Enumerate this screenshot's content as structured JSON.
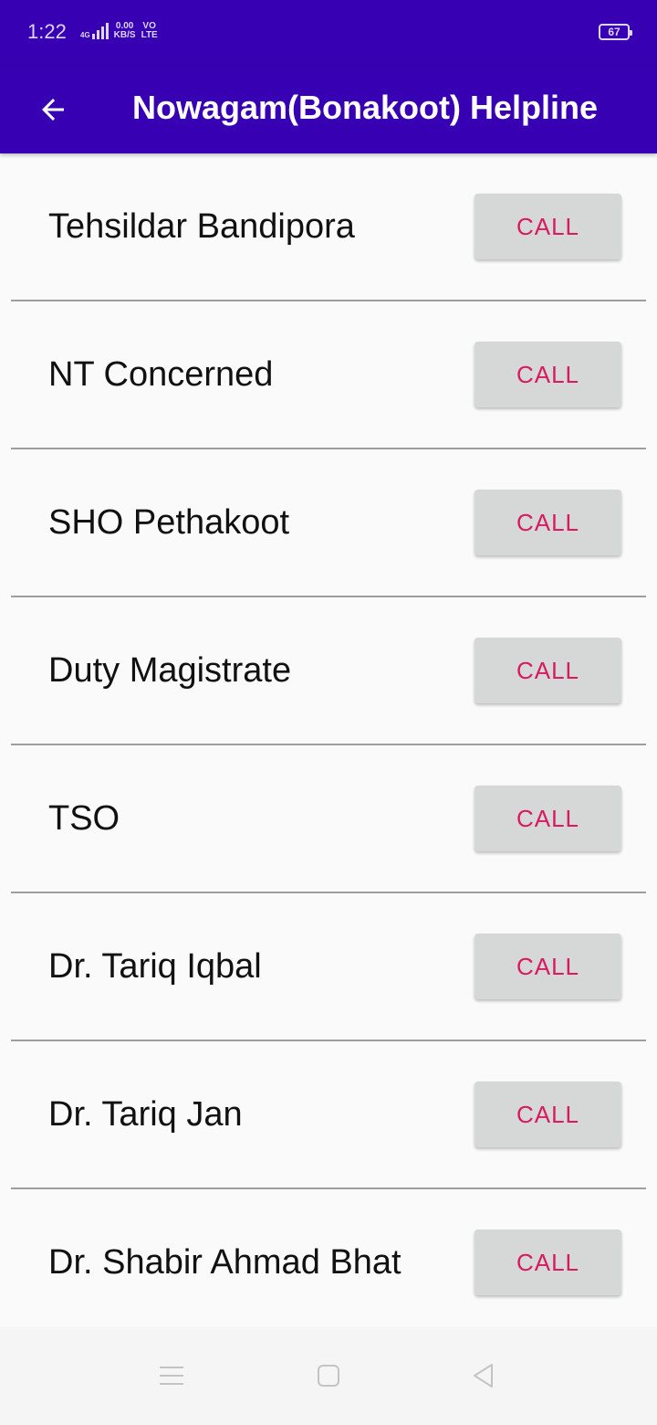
{
  "status_bar": {
    "time": "1:22",
    "network": "4G",
    "speed_value": "0.00",
    "speed_unit": "KB/S",
    "volte_top": "VO",
    "volte_bottom": "LTE",
    "battery": "67"
  },
  "app_bar": {
    "title": "Nowagam(Bonakoot) Helpline",
    "back_icon": "arrow-left-icon"
  },
  "contacts": [
    {
      "name": "Tehsildar Bandipora",
      "button_label": "CALL"
    },
    {
      "name": "NT Concerned",
      "button_label": "CALL"
    },
    {
      "name": "SHO Pethakoot",
      "button_label": "CALL"
    },
    {
      "name": "Duty Magistrate",
      "button_label": "CALL"
    },
    {
      "name": "TSO",
      "button_label": "CALL"
    },
    {
      "name": "Dr. Tariq Iqbal",
      "button_label": "CALL"
    },
    {
      "name": "Dr. Tariq Jan",
      "button_label": "CALL"
    },
    {
      "name": "Dr. Shabir Ahmad Bhat",
      "button_label": "CALL"
    }
  ],
  "nav_bar": {
    "menu_icon": "menu-icon",
    "home_icon": "home-square-icon",
    "back_icon": "back-triangle-icon"
  },
  "colors": {
    "primary": "#3700b3",
    "accent": "#d81b60",
    "button_bg": "#d6d7d7",
    "background": "#fafafa"
  }
}
